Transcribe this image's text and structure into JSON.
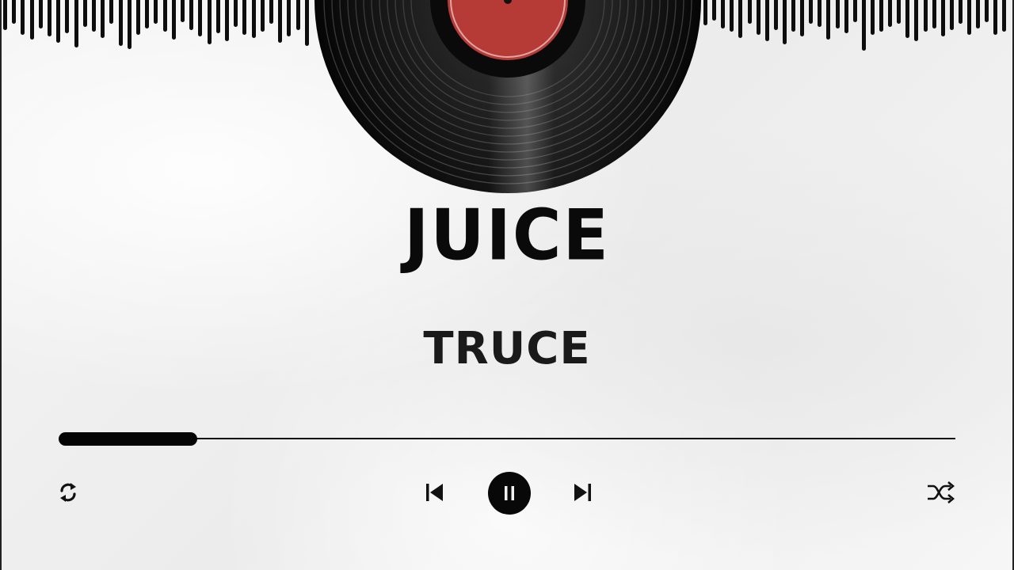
{
  "track": {
    "title": "JUICE",
    "artist": "TRUCE",
    "progress_fraction": 0.155
  },
  "controls": {
    "repeat_icon": "repeat-icon",
    "previous_icon": "skip-previous-icon",
    "play_pause_icon": "pause-icon",
    "next_icon": "skip-next-icon",
    "shuffle_icon": "shuffle-icon"
  },
  "colors": {
    "background": "#f2f2f2",
    "foreground": "#0a0a0a",
    "record_label": "#b63a36"
  }
}
